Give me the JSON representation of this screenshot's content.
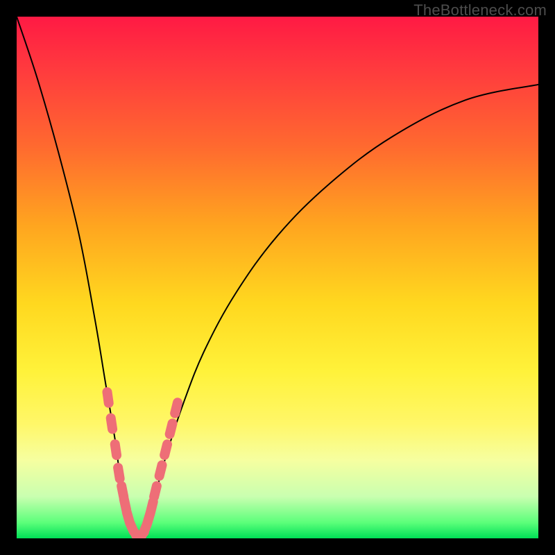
{
  "watermark": "TheBottleneck.com",
  "colors": {
    "background_frame": "#000000",
    "gradient_top": "#ff1a44",
    "gradient_bottom": "#00e056",
    "curve": "#000000",
    "marker": "#ee6e77"
  },
  "chart_data": {
    "type": "line",
    "title": "",
    "xlabel": "",
    "ylabel": "",
    "xlim": [
      0,
      100
    ],
    "ylim": [
      0,
      100
    ],
    "grid": false,
    "legend": false,
    "note": "Bottleneck-style V curve. x is a normalized hardware-balance axis (0-100). y is bottleneck percentage (0 = no bottleneck, 100 = full bottleneck). Minimum at x ≈ 23. Values estimated from pixel positions; no axis ticks present.",
    "series": [
      {
        "name": "bottleneck-curve",
        "x": [
          0,
          4,
          8,
          12,
          15,
          17,
          19,
          20,
          21,
          22,
          23,
          24,
          25,
          26,
          27,
          29,
          32,
          36,
          42,
          50,
          60,
          72,
          86,
          100
        ],
        "y": [
          100,
          88,
          74,
          58,
          42,
          30,
          18,
          10,
          5,
          2,
          0,
          2,
          4,
          7,
          10,
          17,
          26,
          36,
          47,
          58,
          68,
          77,
          84,
          87
        ]
      }
    ],
    "markers": {
      "name": "highlighted-points",
      "note": "Pink capsule markers clustered near the trough of the V.",
      "points": [
        {
          "x": 17.5,
          "y": 27
        },
        {
          "x": 18.2,
          "y": 22
        },
        {
          "x": 19.0,
          "y": 17
        },
        {
          "x": 19.6,
          "y": 12.5
        },
        {
          "x": 20.3,
          "y": 9
        },
        {
          "x": 20.8,
          "y": 6.5
        },
        {
          "x": 21.4,
          "y": 4
        },
        {
          "x": 22.0,
          "y": 2.3
        },
        {
          "x": 22.7,
          "y": 1
        },
        {
          "x": 23.4,
          "y": 0.5
        },
        {
          "x": 24.1,
          "y": 0.8
        },
        {
          "x": 24.7,
          "y": 2
        },
        {
          "x": 25.3,
          "y": 3.8
        },
        {
          "x": 25.9,
          "y": 6
        },
        {
          "x": 26.6,
          "y": 9
        },
        {
          "x": 27.6,
          "y": 13
        },
        {
          "x": 28.6,
          "y": 17
        },
        {
          "x": 29.6,
          "y": 21
        },
        {
          "x": 30.6,
          "y": 25
        }
      ]
    }
  }
}
